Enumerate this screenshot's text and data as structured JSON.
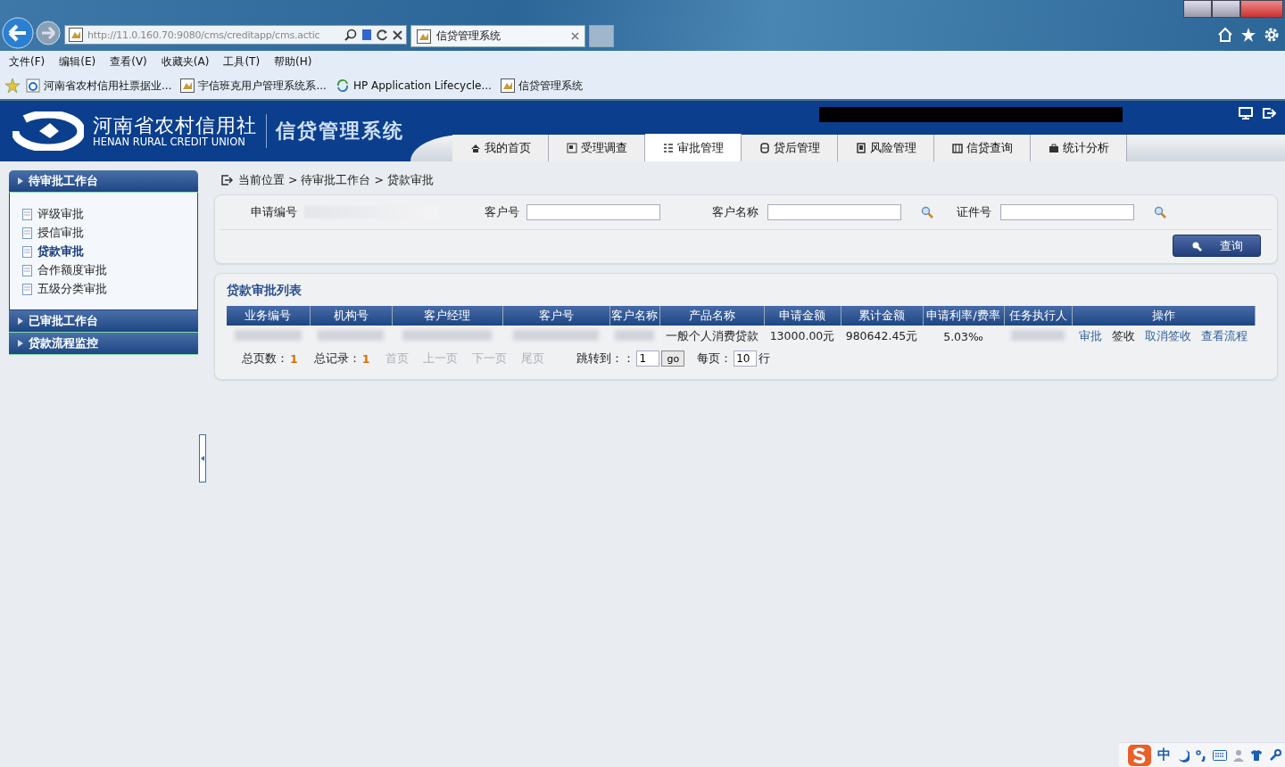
{
  "browser": {
    "url": "http://11.0.160.70:9080/cms/creditapp/cms.actic",
    "tab_title": "信贷管理系统",
    "menu": [
      "文件(F)",
      "编辑(E)",
      "查看(V)",
      "收藏夹(A)",
      "工具(T)",
      "帮助(H)"
    ],
    "favorites": [
      {
        "label": "河南省农村信用社票据业...",
        "kind": "ie"
      },
      {
        "label": "宇信班克用户管理系统系...",
        "kind": "app"
      },
      {
        "label": "HP Application Lifecycle...",
        "kind": "hp"
      },
      {
        "label": "信贷管理系统",
        "kind": "app"
      }
    ]
  },
  "header": {
    "logo_cn": "河南省农村信用社",
    "logo_en": "HENAN RURAL CREDIT UNION",
    "system_name": "信贷管理系统",
    "tabs": [
      {
        "label": "我的首页",
        "selected": false
      },
      {
        "label": "受理调查",
        "selected": false
      },
      {
        "label": "审批管理",
        "selected": true
      },
      {
        "label": "贷后管理",
        "selected": false
      },
      {
        "label": "风险管理",
        "selected": false
      },
      {
        "label": "信贷查询",
        "selected": false
      },
      {
        "label": "统计分析",
        "selected": false
      }
    ]
  },
  "sidebar": {
    "sections": [
      {
        "title": "待审批工作台",
        "expanded": true,
        "items": [
          {
            "label": "评级审批",
            "selected": false
          },
          {
            "label": "授信审批",
            "selected": false
          },
          {
            "label": "贷款审批",
            "selected": true
          },
          {
            "label": "合作额度审批",
            "selected": false
          },
          {
            "label": "五级分类审批",
            "selected": false
          }
        ]
      },
      {
        "title": "已审批工作台"
      },
      {
        "title": "贷款流程监控"
      }
    ]
  },
  "breadcrumb": "当前位置 > 待审批工作台 > 贷款审批",
  "search": {
    "fields": [
      {
        "label": "申请编号",
        "kind": "masked"
      },
      {
        "label": "客户号",
        "kind": "text"
      },
      {
        "label": "客户名称",
        "kind": "lookup"
      },
      {
        "label": "证件号",
        "kind": "lookup"
      }
    ],
    "button": "查询"
  },
  "list": {
    "title": "贷款审批列表",
    "columns": [
      "业务编号",
      "机构号",
      "客户经理",
      "客户号",
      "客户名称",
      "产品名称",
      "申请金额",
      "累计金额",
      "申请利率/费率",
      "任务执行人",
      "操作"
    ],
    "rows": [
      {
        "cells": [
          {
            "masked": true
          },
          {
            "masked": true
          },
          {
            "masked": true
          },
          {
            "masked": true
          },
          {
            "masked": true
          },
          {
            "text": "一般个人消费贷款"
          },
          {
            "text": "13000.00元"
          },
          {
            "text": "980642.45元"
          },
          {
            "text": "5.03‰"
          },
          {
            "masked": true
          }
        ],
        "actions": [
          {
            "label": "审批",
            "kind": "link"
          },
          {
            "label": "签收",
            "kind": "plain"
          },
          {
            "label": "取消签收",
            "kind": "link"
          },
          {
            "label": "查看流程",
            "kind": "link"
          }
        ]
      }
    ]
  },
  "pager": {
    "pages_label": "总页数：",
    "pages": "1",
    "records_label": "总记录：",
    "records": "1",
    "nav": [
      {
        "label": "首页",
        "disabled": true
      },
      {
        "label": "上一页",
        "disabled": true
      },
      {
        "label": "下一页",
        "disabled": true
      },
      {
        "label": "尾页",
        "disabled": true
      }
    ],
    "jump_label": "跳转到：：",
    "jump_value": "1",
    "go": "go",
    "per_page_label": "每页：",
    "per_page": "10",
    "unit": "行"
  },
  "ime": {
    "label": "中"
  }
}
